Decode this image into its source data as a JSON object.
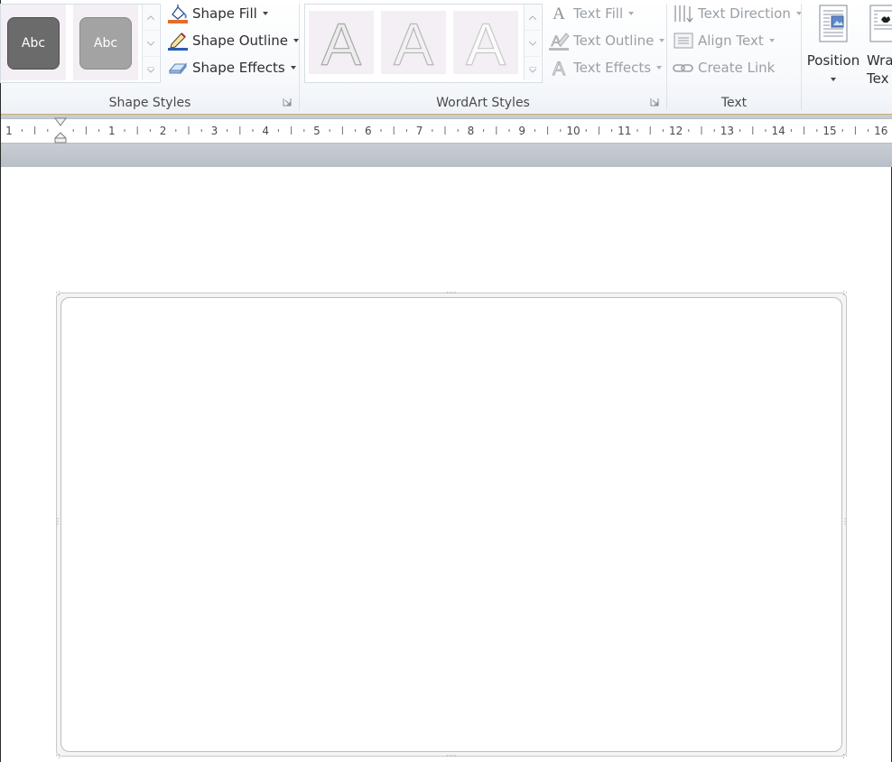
{
  "ribbon": {
    "shape_styles": {
      "label": "Shape Styles",
      "swatch1": "Abc",
      "swatch2": "Abc",
      "shape_fill": "Shape Fill",
      "shape_outline": "Shape Outline",
      "shape_effects": "Shape Effects"
    },
    "wordart_styles": {
      "label": "WordArt Styles",
      "sample": "A",
      "text_fill": "Text Fill",
      "text_outline": "Text Outline",
      "text_effects": "Text Effects"
    },
    "text": {
      "label": "Text",
      "text_direction": "Text Direction",
      "align_text": "Align Text",
      "create_link": "Create Link"
    },
    "arrange": {
      "position": "Position",
      "wrap_text_line1": "Wra",
      "wrap_text_line2": "Tex"
    }
  },
  "ruler": {
    "labels": [
      "1",
      "1",
      "2",
      "3",
      "4",
      "5",
      "6",
      "7",
      "8",
      "9",
      "10",
      "11",
      "12",
      "13",
      "14",
      "15",
      "16"
    ]
  },
  "colors": {
    "swatch_dark": "#6b6b6b",
    "swatch_light": "#a3a3a3",
    "fill_accent": "#e36c2a",
    "outline_accent": "#2a5db0"
  }
}
